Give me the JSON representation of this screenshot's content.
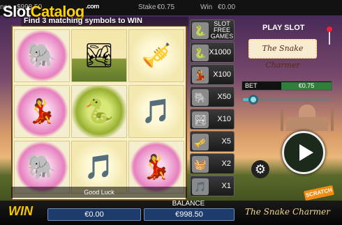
{
  "top_bar": {
    "balance_prefix": "nce",
    "balance_value": "$998.50",
    "stake_label": "Stake",
    "stake_value": "€0.75",
    "win_label": "Win",
    "win_value": "€0.00"
  },
  "watermark": {
    "slot": "Slot",
    "catalog": "Catalog",
    "com": ".com"
  },
  "instruction": "Find 3 matching symbols to WIN",
  "reels": [
    {
      "symbol": "elephant-symbol",
      "glyph": "🐘",
      "style": "pink"
    },
    {
      "symbol": "landscape-symbol",
      "glyph": "🏞",
      "style": "land"
    },
    {
      "symbol": "pungi-flute-symbol",
      "glyph": "🎺",
      "style": "notes"
    },
    {
      "symbol": "dancer-symbol",
      "glyph": "💃",
      "style": "pink"
    },
    {
      "symbol": "cobra-symbol",
      "glyph": "🐍",
      "style": "snake"
    },
    {
      "symbol": "music-notes-symbol",
      "glyph": "🎵",
      "style": "notes"
    },
    {
      "symbol": "elephant-symbol",
      "glyph": "🐘",
      "style": "pink"
    },
    {
      "symbol": "music-notes-symbol",
      "glyph": "🎵",
      "style": "notes"
    },
    {
      "symbol": "dancer-symbol",
      "glyph": "💃",
      "style": "pink"
    }
  ],
  "good_luck": "Good Luck",
  "paytable": [
    {
      "glyph": "🐍",
      "label": "SLOT FREE GAMES",
      "type": "free"
    },
    {
      "glyph": "🐍",
      "label": "X1000",
      "type": "mult"
    },
    {
      "glyph": "💃",
      "label": "X100",
      "type": "mult"
    },
    {
      "glyph": "🐘",
      "label": "X50",
      "type": "mult"
    },
    {
      "glyph": "🏞",
      "label": "X10",
      "type": "mult"
    },
    {
      "glyph": "🎺",
      "label": "X5",
      "type": "mult"
    },
    {
      "glyph": "🧺",
      "label": "X2",
      "type": "mult"
    },
    {
      "glyph": "🎵",
      "label": "X1",
      "type": "mult"
    }
  ],
  "play_slot": "PLAY SLOT",
  "game_logo": "The Snake Charmer",
  "bet": {
    "label": "BET",
    "value": "€0.75",
    "slider_fraction": 0.12
  },
  "bottom": {
    "win_label": "WIN",
    "win_value": "€0.00",
    "balance_label": "BALANCE",
    "balance_value": "€998.50",
    "logo": "The Snake Charmer",
    "badge": "SCRATCH"
  },
  "colors": {
    "accent_gold": "#f5c400",
    "value_box": "#1d3c6b",
    "bet_green": "#2f7f3a"
  }
}
